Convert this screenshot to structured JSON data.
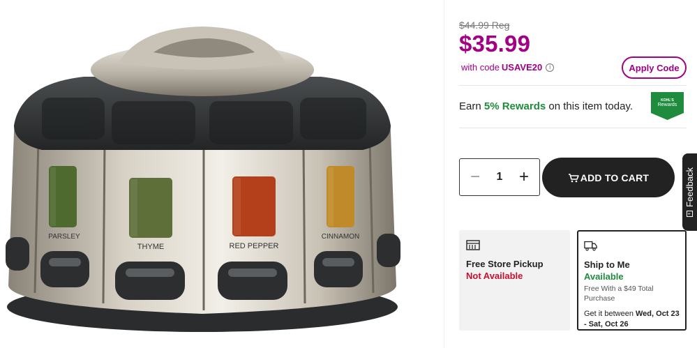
{
  "product_image": {
    "jar_labels": [
      "PARSLEY",
      "THYME",
      "RED PEPPER",
      "CINNAMON"
    ]
  },
  "price": {
    "regular": "$44.99 Reg",
    "sale": "$35.99",
    "code_prefix": "with code",
    "code": "USAVE20",
    "info_symbol": "i",
    "apply_label": "Apply Code"
  },
  "rewards": {
    "text_before": "Earn ",
    "highlight": "5% Rewards",
    "text_after": " on this item today.",
    "badge_text_top": "KOHL'S",
    "badge_text_bottom": "Rewards",
    "badge_color": "#1e8c3c"
  },
  "quantity": {
    "minus_symbol": "−",
    "value": "1",
    "plus_symbol": "+"
  },
  "cart": {
    "label": "ADD TO CART",
    "icon": "cart-icon"
  },
  "fulfillment": {
    "pickup": {
      "icon": "store-icon",
      "title": "Free Store Pickup",
      "status": "Not Available"
    },
    "ship": {
      "icon": "truck-icon",
      "title": "Ship to Me",
      "status": "Available",
      "note": "Free With a $49 Total Purchase",
      "date_prefix": "Get it between ",
      "date_range": "Wed, Oct 23 - Sat, Oct 26"
    }
  },
  "feedback": {
    "label": "Feedback",
    "icon_symbol": "+"
  },
  "colors": {
    "accent": "#a20085",
    "success": "#1e8c3c",
    "error": "#c8102e",
    "dark": "#222222"
  }
}
